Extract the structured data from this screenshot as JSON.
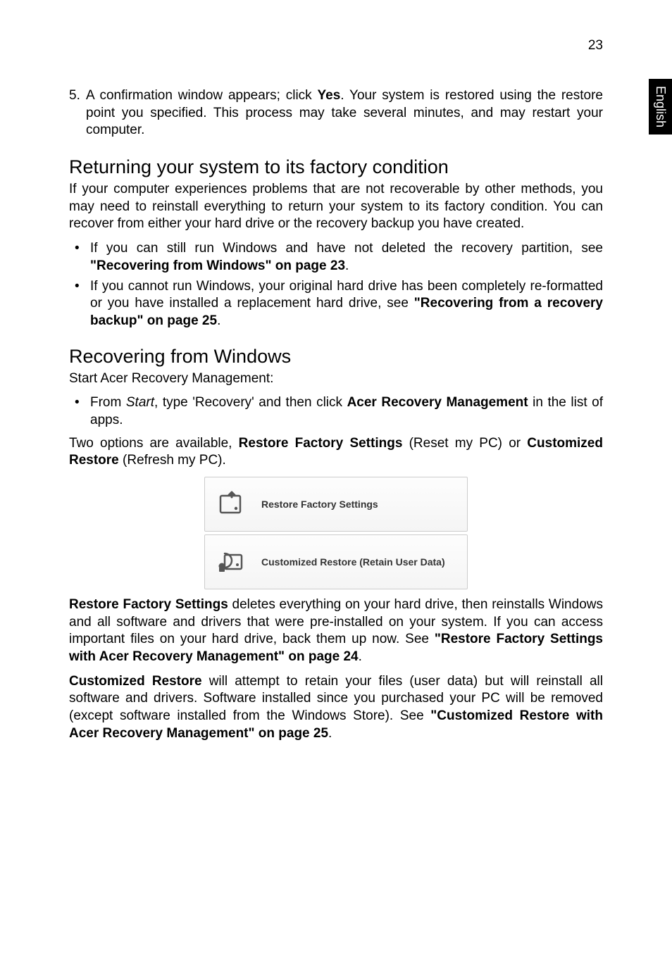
{
  "page_number": "23",
  "side_label": "English",
  "step5": {
    "num": "5.",
    "pre": "A confirmation window appears; click ",
    "yes": "Yes",
    "post": ". Your system is restored using the restore point you specified. This process may take several minutes, and may restart your computer."
  },
  "sec1": {
    "heading": "Returning your system to its factory condition",
    "para": "If your computer experiences problems that are not recoverable by other methods, you may need to reinstall everything to return your system to its factory condition. You can recover from either your hard drive or the recovery backup you have created.",
    "b1_pre": "If you can still run Windows and have not deleted the recovery partition, see ",
    "b1_link": "\"Recovering from Windows\" on page 23",
    "b1_post": ".",
    "b2_pre": "If you cannot run Windows, your original hard drive has been completely re-formatted or you have installed a replacement hard drive, see ",
    "b2_link": "\"Recovering from a recovery backup\" on page 25",
    "b2_post": "."
  },
  "sec2": {
    "heading": "Recovering from Windows",
    "intro": "Start Acer Recovery Management:",
    "b1_pre": "From ",
    "b1_start": "Start",
    "b1_mid": ", type 'Recovery' and then click ",
    "b1_bold": "Acer Recovery Management",
    "b1_post": " in the list of apps.",
    "two_opts_pre": "Two options are available, ",
    "two_opts_b1": "Restore Factory Settings",
    "two_opts_mid1": " (Reset my PC) or ",
    "two_opts_b2": "Customized Restore",
    "two_opts_post": " (Refresh my PC).",
    "fig_btn1": "Restore Factory Settings",
    "fig_btn2": "Customized Restore (Retain User Data)",
    "rfs_b": "Restore Factory Settings",
    "rfs_txt": " deletes everything on your hard drive, then reinstalls Windows and all software and drivers that were pre-installed on your system. If you can access important files on your hard drive, back them up now. See ",
    "rfs_link": "\"Restore Factory Settings with Acer Recovery Management\" on page 24",
    "rfs_post": ".",
    "cr_b": "Customized Restore",
    "cr_txt": " will attempt to retain your files (user data) but will reinstall all software and drivers. Software installed since you purchased your PC will be removed (except software installed from the Windows Store). See ",
    "cr_link": "\"Customized Restore with Acer Recovery Management\" on page 25",
    "cr_post": "."
  },
  "bullet_char": "•"
}
